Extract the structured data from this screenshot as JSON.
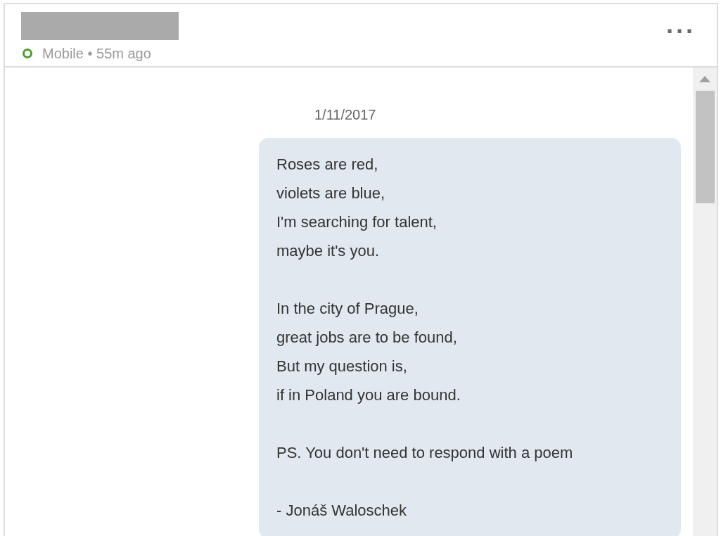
{
  "header": {
    "name_redacted": true,
    "online": true,
    "status": "Mobile • 55m ago",
    "menu": "···"
  },
  "conversation": {
    "date": "1/11/2017",
    "messages": [
      {
        "stanzas": [
          [
            "Roses are red,",
            "violets are blue,",
            "I'm searching for talent,",
            "maybe it's you."
          ],
          [
            "In the city of Prague,",
            "great jobs are to be found,",
            "But my question is,",
            "if in Poland you are bound."
          ],
          [
            "PS. You don't need to respond with a poem"
          ],
          [
            "- Jonáš Waloschek"
          ]
        ]
      }
    ]
  }
}
